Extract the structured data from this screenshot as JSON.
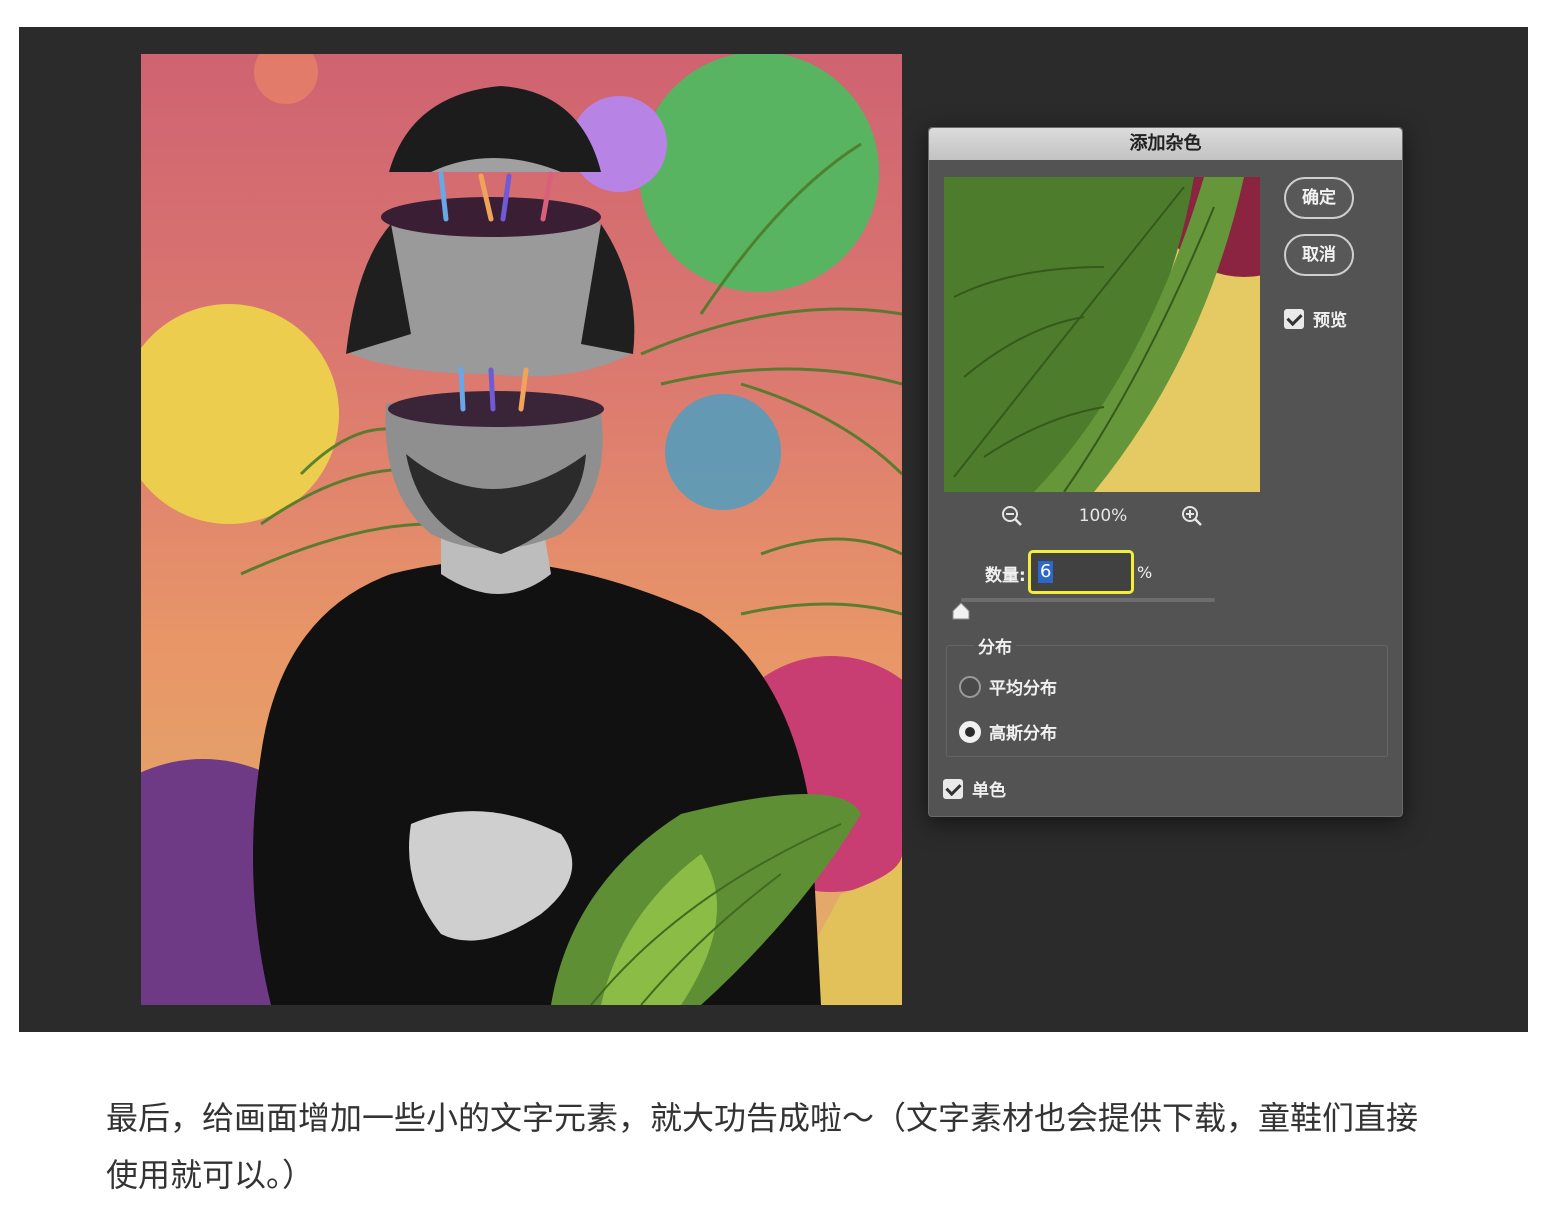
{
  "dialog": {
    "title": "添加杂色",
    "ok_label": "确定",
    "cancel_label": "取消",
    "preview_label": "预览",
    "preview_checked": true,
    "zoom_level": "100%",
    "amount_label": "数量:",
    "amount_value": "6",
    "amount_unit": "%",
    "amount_fraction": 0.06,
    "distribution": {
      "title": "分布",
      "options": [
        {
          "label": "平均分布",
          "selected": false
        },
        {
          "label": "高斯分布",
          "selected": true
        }
      ]
    },
    "monochromatic_label": "单色",
    "monochromatic_checked": true
  },
  "caption": "最后，给画面增加一些小的文字元素，就大功告成啦～（文字素材也会提供下载，童鞋们直接使用就可以。）",
  "colors": {
    "workspace_bg": "#2b2b2b",
    "dialog_bg": "#535353",
    "input_highlight": "#f2ee3a",
    "selection_blue": "#2d67c7"
  },
  "icons": {
    "zoom_out": "zoom-out-icon",
    "zoom_in": "zoom-in-icon",
    "slider": "slider-thumb-icon"
  }
}
